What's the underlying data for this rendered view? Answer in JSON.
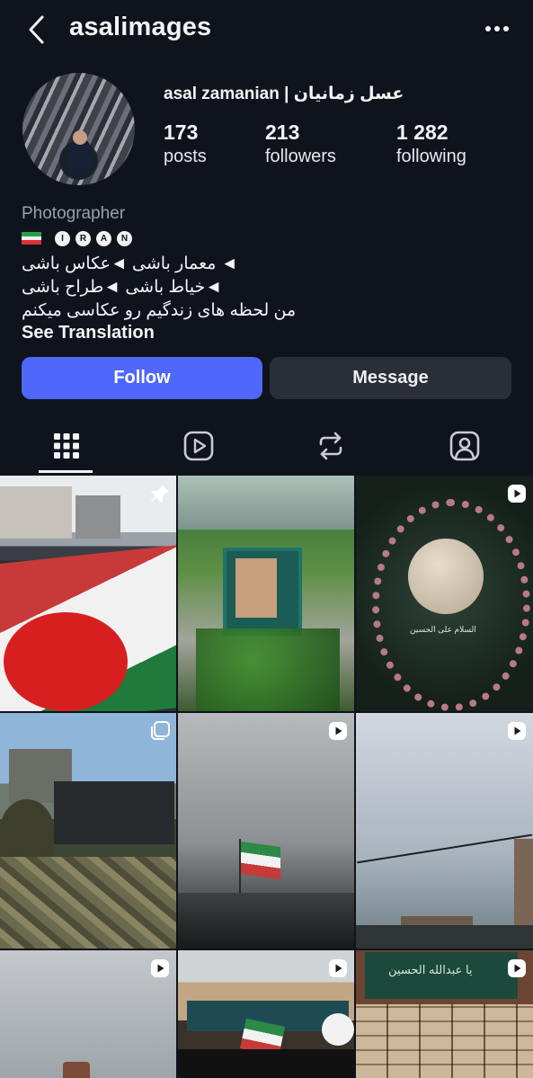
{
  "header": {
    "username": "asalimages",
    "back_icon": "chevron-left-icon",
    "more_icon": "more-horizontal-icon"
  },
  "profile": {
    "full_name": "asal zamanian | عسل زمانیان",
    "stats": [
      {
        "value": "173",
        "label": "posts"
      },
      {
        "value": "213",
        "label": "followers"
      },
      {
        "value": "1 282",
        "label": "following"
      }
    ],
    "category": "Photographer",
    "country_letters": [
      "I",
      "R",
      "A",
      "N"
    ],
    "bio_lines": [
      "◄ معمار باشی ◄عکاس باشی",
      "◄خیاط باشی ◄طراح باشی",
      "من لحظه های زندگیم رو عکاسی میکنم"
    ],
    "see_translation": "See Translation"
  },
  "actions": {
    "follow": "Follow",
    "message": "Message"
  },
  "tabs": [
    {
      "name": "grid",
      "icon": "grid-icon",
      "active": true
    },
    {
      "name": "reels",
      "icon": "reels-play-icon",
      "active": false
    },
    {
      "name": "reposts",
      "icon": "repost-icon",
      "active": false
    },
    {
      "name": "tagged",
      "icon": "tagged-person-icon",
      "active": false
    }
  ],
  "posts": [
    {
      "id": "post-1",
      "badge": "pin-icon",
      "subject": "flag-crowd"
    },
    {
      "id": "post-2",
      "badge": "",
      "subject": "memorial-frame"
    },
    {
      "id": "post-3",
      "badge": "reel-icon",
      "subject": "prayer-stone",
      "caption": "السلام علی الحسین"
    },
    {
      "id": "post-4",
      "badge": "carousel-icon",
      "subject": "salute-soldier"
    },
    {
      "id": "post-5",
      "badge": "reel-icon",
      "subject": "flag-sky"
    },
    {
      "id": "post-6",
      "badge": "reel-icon",
      "subject": "sky-buildings"
    },
    {
      "id": "post-7",
      "badge": "reel-icon",
      "subject": "cloudy-sky"
    },
    {
      "id": "post-8",
      "badge": "reel-icon",
      "subject": "crowd-flag"
    },
    {
      "id": "post-9",
      "badge": "reel-icon",
      "subject": "tile-wall",
      "caption": "یا عبدالله الحسین"
    }
  ],
  "colors": {
    "background": "#0f131c",
    "follow_button": "#4f67fb",
    "message_button": "#2a2e36",
    "muted_text": "#9aa0aa"
  }
}
